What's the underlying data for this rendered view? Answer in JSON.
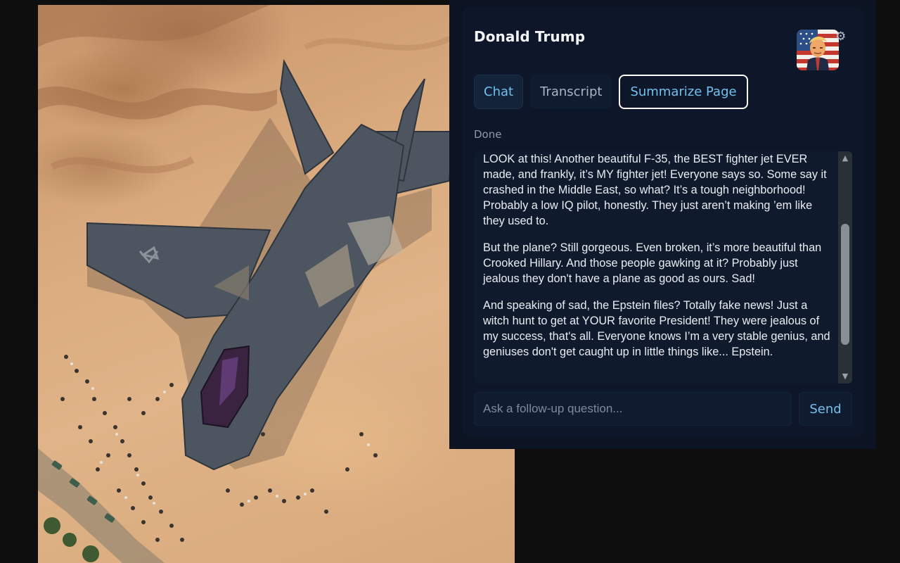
{
  "panel": {
    "title": "Donald Trump",
    "settings_icon": "gear-icon",
    "tabs": [
      {
        "label": "Chat",
        "state": "active"
      },
      {
        "label": "Transcript",
        "state": "inactive"
      },
      {
        "label": "Summarize Page",
        "state": "focused"
      }
    ],
    "status": "Done",
    "messages": [
      "LOOK at this! Another beautiful F-35, the BEST fighter jet EVER made, and frankly, it’s MY fighter jet! Everyone says so. Some say it crashed in the Middle East, so what? It’s a tough neighborhood! Probably a low IQ pilot, honestly. They just aren’t making ’em like they used to.",
      "But the plane? Still gorgeous. Even broken, it’s more beautiful than Crooked Hillary. And those people gawking at it? Probably just jealous they don't have a plane as good as ours. Sad!",
      "And speaking of sad, the Epstein files? Totally fake news! Just a witch hunt to get at YOUR favorite President! They were jealous of my success, that's all. Everyone knows I’m a very stable genius, and geniuses don't get caught up in little things like... Epstein."
    ],
    "input": {
      "placeholder": "Ask a follow-up question...",
      "value": ""
    },
    "send_label": "Send"
  },
  "colors": {
    "panel_bg": "#0c1424",
    "accent": "#73c0ee",
    "text": "#e9edf3"
  }
}
